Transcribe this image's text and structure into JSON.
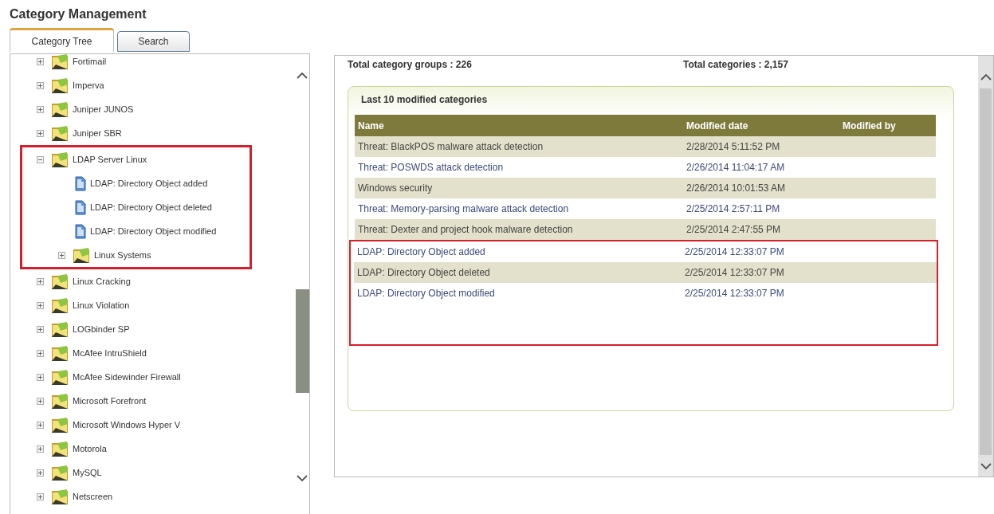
{
  "page_title": "Category Management",
  "tabs": [
    {
      "label": "Category Tree",
      "selected": true
    },
    {
      "label": "Search",
      "selected": false
    }
  ],
  "tree": [
    {
      "label": "Fortimail",
      "kind": "folder",
      "expanded": false,
      "highlighted": false
    },
    {
      "label": "Imperva",
      "kind": "folder",
      "expanded": false,
      "highlighted": false
    },
    {
      "label": "Juniper JUNOS",
      "kind": "folder",
      "expanded": false,
      "highlighted": false
    },
    {
      "label": "Juniper SBR",
      "kind": "folder",
      "expanded": false,
      "highlighted": false
    },
    {
      "label": "LDAP Server Linux",
      "kind": "folder",
      "expanded": true,
      "highlighted": true,
      "children": [
        {
          "label": "LDAP: Directory Object added",
          "kind": "document"
        },
        {
          "label": "LDAP: Directory Object deleted",
          "kind": "document"
        },
        {
          "label": "LDAP: Directory Object modified",
          "kind": "document"
        },
        {
          "label": "Linux Systems",
          "kind": "folder",
          "expanded": false
        }
      ]
    },
    {
      "label": "Linux Cracking",
      "kind": "folder",
      "expanded": false,
      "highlighted": false
    },
    {
      "label": "Linux Violation",
      "kind": "folder",
      "expanded": false,
      "highlighted": false
    },
    {
      "label": "LOGbinder SP",
      "kind": "folder",
      "expanded": false,
      "highlighted": false
    },
    {
      "label": "McAfee IntruShield",
      "kind": "folder",
      "expanded": false,
      "highlighted": false
    },
    {
      "label": "McAfee Sidewinder Firewall",
      "kind": "folder",
      "expanded": false,
      "highlighted": false
    },
    {
      "label": "Microsoft Forefront",
      "kind": "folder",
      "expanded": false,
      "highlighted": false
    },
    {
      "label": "Microsoft Windows Hyper V",
      "kind": "folder",
      "expanded": false,
      "highlighted": false
    },
    {
      "label": "Motorola",
      "kind": "folder",
      "expanded": false,
      "highlighted": false
    },
    {
      "label": "MySQL",
      "kind": "folder",
      "expanded": false,
      "highlighted": false
    },
    {
      "label": "Netscreen",
      "kind": "folder",
      "expanded": false,
      "highlighted": false
    }
  ],
  "summary": {
    "groups": "Total category groups : 226",
    "categories": "Total categories : 2,157"
  },
  "recent_panel": {
    "title": "Last 10 modified categories",
    "columns": [
      "Name",
      "Modified date",
      "Modified by"
    ],
    "rows": [
      {
        "name": "Threat: BlackPOS malware attack detection",
        "date": "2/28/2014 5:11:52 PM",
        "highlighted": false
      },
      {
        "name": "Threat: POSWDS attack detection",
        "date": "2/26/2014 11:04:17 AM",
        "highlighted": false
      },
      {
        "name": "Windows security",
        "date": "2/26/2014 10:01:53 AM",
        "highlighted": false
      },
      {
        "name": "Threat: Memory-parsing malware attack detection",
        "date": "2/25/2014 2:57:11 PM",
        "highlighted": false
      },
      {
        "name": "Threat: Dexter and project hook malware detection",
        "date": "2/25/2014 2:47:55 PM",
        "highlighted": false
      },
      {
        "name": "LDAP: Directory Object added",
        "date": "2/25/2014 12:33:07 PM",
        "highlighted": true
      },
      {
        "name": "LDAP: Directory Object deleted",
        "date": "2/25/2014 12:33:07 PM",
        "highlighted": true
      },
      {
        "name": "LDAP: Directory Object modified",
        "date": "2/25/2014 12:33:07 PM",
        "highlighted": true
      }
    ]
  }
}
